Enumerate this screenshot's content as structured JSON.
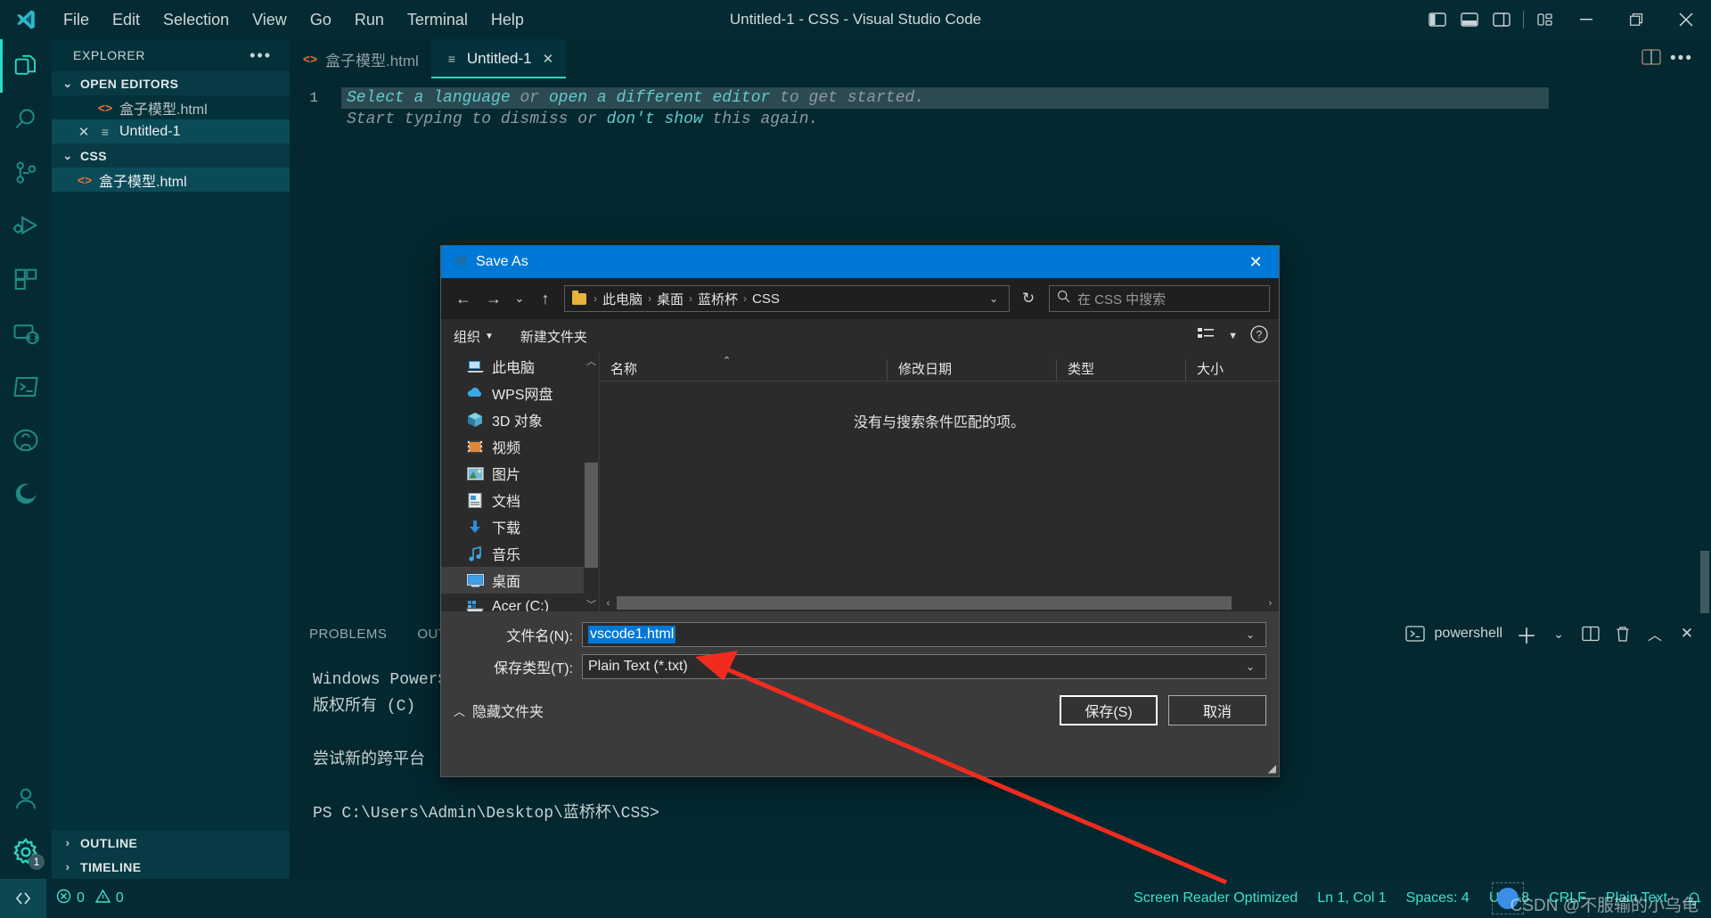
{
  "window": {
    "title": "Untitled-1 - CSS - Visual Studio Code",
    "minimize": "minimize-icon",
    "restore": "restore-icon",
    "close": "close-icon"
  },
  "menubar": {
    "items": [
      "File",
      "Edit",
      "Selection",
      "View",
      "Go",
      "Run",
      "Terminal",
      "Help"
    ]
  },
  "activitybar": {
    "items": [
      {
        "name": "explorer-icon",
        "active": true
      },
      {
        "name": "search-icon",
        "active": false
      },
      {
        "name": "source-control-icon",
        "active": false
      },
      {
        "name": "run-and-debug-icon",
        "active": false
      },
      {
        "name": "extensions-icon",
        "active": false
      },
      {
        "name": "remote-explorer-icon",
        "active": false
      },
      {
        "name": "terminal-icon",
        "active": false
      },
      {
        "name": "github-icon",
        "active": false
      },
      {
        "name": "edge-tools-icon",
        "active": false
      }
    ],
    "accounts_icon": "accounts-icon",
    "settings_icon": "settings-gear-icon",
    "settings_badge": "1"
  },
  "sidebar": {
    "header": "EXPLORER",
    "more_actions": "ellipsis-icon",
    "sections": [
      {
        "label": "OPEN EDITORS",
        "items": [
          {
            "label": "盒子模型.html",
            "icon": "html-file-icon",
            "selected": false,
            "closable": false
          },
          {
            "label": "Untitled-1",
            "icon": "text-file-icon",
            "selected": true,
            "closable": true
          }
        ]
      },
      {
        "label": "CSS",
        "items": [
          {
            "label": "盒子模型.html",
            "icon": "html-file-icon",
            "selected": false,
            "closable": false
          }
        ]
      }
    ],
    "collapsed": [
      "OUTLINE",
      "TIMELINE"
    ]
  },
  "editor": {
    "tabs": [
      {
        "label": "盒子模型.html",
        "icon": "html-file-icon",
        "active": false,
        "closable": false
      },
      {
        "label": "Untitled-1",
        "icon": "text-file-icon",
        "active": true,
        "closable": true
      }
    ],
    "line_number": "1",
    "placeholder_line1_a": "Select a language",
    "placeholder_line1_b": " or ",
    "placeholder_line1_c": "open a different editor",
    "placeholder_line1_d": " to get started.",
    "placeholder_line2_a": "Start typing to dismiss or ",
    "placeholder_line2_b": "don't show",
    "placeholder_line2_c": " this again.",
    "split_editor_icon": "split-editor-icon",
    "more_actions_icon": "ellipsis-icon"
  },
  "panel": {
    "tabs": [
      "PROBLEMS",
      "OUTPUT"
    ],
    "terminal_name": "powershell",
    "terminal_icon": "powershell-icon",
    "new_terminal_icon": "plus-icon",
    "terminal_dropdown_icon": "chevron-down-icon",
    "split_terminal_icon": "split-icon",
    "kill_terminal_icon": "trash-icon",
    "maximize_panel_icon": "chevron-up-icon",
    "close_panel_icon": "close-icon",
    "lines": [
      "Windows PowerShell",
      "版权所有 (C) ",
      "",
      "尝试新的跨平台",
      "",
      "PS C:\\Users\\Admin\\Desktop\\蓝桥杯\\CSS>"
    ]
  },
  "statusbar": {
    "remote_icon": "remote-window-icon",
    "errors_icon": "error-icon",
    "errors": "0",
    "warnings_icon": "warning-icon",
    "warnings": "0",
    "screen_reader": "Screen Reader Optimized",
    "cursor": "Ln 1, Col 1",
    "indentation": "Spaces: 4",
    "encoding": "UTF-8",
    "eol": "CRLF",
    "language": "Plain Text",
    "bell_icon": "bell-icon"
  },
  "dialog": {
    "title": "Save As",
    "title_icon": "vscode-icon",
    "close_icon": "close-icon",
    "nav": {
      "back_icon": "arrow-left-icon",
      "forward_icon": "arrow-right-icon",
      "recent_icon": "chevron-down-icon",
      "up_icon": "arrow-up-icon",
      "folder_icon": "folder-icon",
      "breadcrumbs": [
        "此电脑",
        "桌面",
        "蓝桥杯",
        "CSS"
      ],
      "dropdown_icon": "chevron-down-icon",
      "refresh_icon": "refresh-icon"
    },
    "search": {
      "icon": "search-icon",
      "placeholder": "在 CSS 中搜索"
    },
    "toolbar": {
      "organize": "组织",
      "organize_caret": "chevron-down-icon",
      "new_folder": "新建文件夹",
      "view_icon": "view-list-icon",
      "view_caret": "chevron-down-icon",
      "help_icon": "help-icon"
    },
    "tree": {
      "scroll_up_icon": "chevron-up-icon",
      "scroll_down_icon": "chevron-down-icon",
      "items": [
        {
          "label": "此电脑",
          "icon": "this-pc-icon",
          "selected": false
        },
        {
          "label": "WPS网盘",
          "icon": "cloud-icon",
          "selected": false
        },
        {
          "label": "3D 对象",
          "icon": "3d-objects-icon",
          "selected": false
        },
        {
          "label": "视频",
          "icon": "videos-icon",
          "selected": false
        },
        {
          "label": "图片",
          "icon": "pictures-icon",
          "selected": false
        },
        {
          "label": "文档",
          "icon": "documents-icon",
          "selected": false
        },
        {
          "label": "下载",
          "icon": "downloads-icon",
          "selected": false
        },
        {
          "label": "音乐",
          "icon": "music-icon",
          "selected": false
        },
        {
          "label": "桌面",
          "icon": "desktop-icon",
          "selected": true
        },
        {
          "label": "Acer (C:)",
          "icon": "drive-icon",
          "selected": false
        }
      ]
    },
    "filelist": {
      "columns": [
        "名称",
        "修改日期",
        "类型",
        "大小"
      ],
      "sort_icon": "sort-ascending-icon",
      "empty_message": "没有与搜索条件匹配的项。",
      "hscroll_left_icon": "chevron-left-icon",
      "hscroll_right_icon": "chevron-right-icon"
    },
    "form": {
      "filename_label": "文件名(N):",
      "filename_value": "vscode1.html",
      "filename_caret": "chevron-down-icon",
      "filetype_label": "保存类型(T):",
      "filetype_value": "Plain Text (*.txt)",
      "filetype_caret": "chevron-down-icon"
    },
    "footer": {
      "hide_folders_icon": "chevron-up-icon",
      "hide_folders": "隐藏文件夹",
      "save_button": "保存(S)",
      "cancel_button": "取消",
      "resize_grip": "resize-grip-icon"
    }
  },
  "annotation": {
    "arrow_color": "#f12c1f",
    "arrow_name": "red-pointer-arrow"
  },
  "watermark": {
    "text": "CSDN @不服输的小乌龟"
  }
}
